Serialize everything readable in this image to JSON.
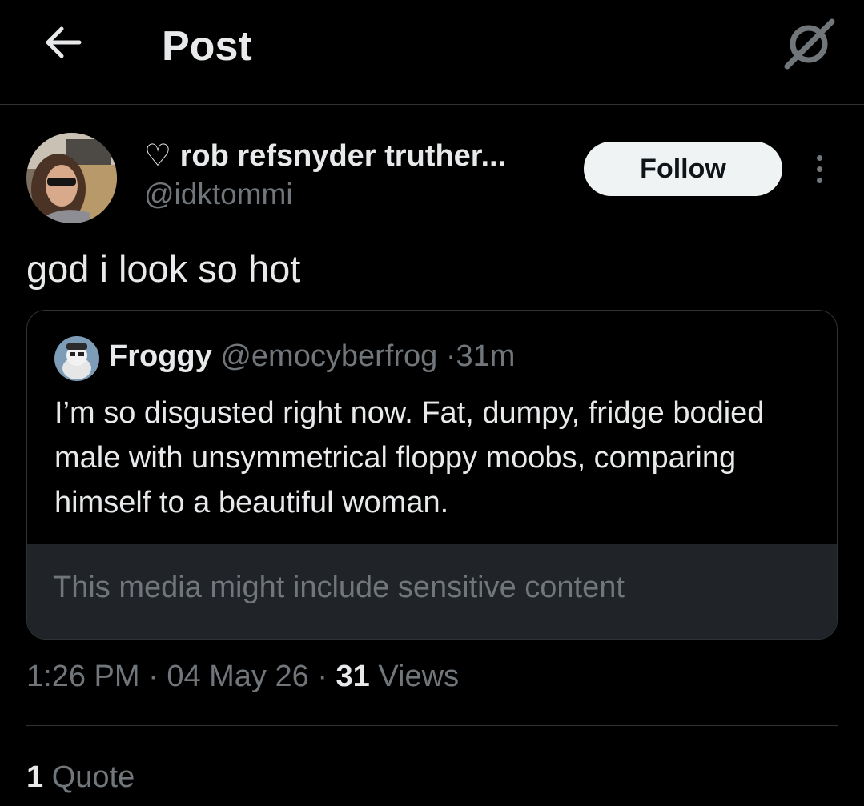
{
  "header": {
    "title": "Post",
    "back_icon": "arrow-left-icon",
    "grok_icon": "grok-icon"
  },
  "author": {
    "display_name": "♡ rob refsnyder truther...",
    "handle": "@idktommi",
    "follow_label": "Follow",
    "more_icon": "more-vertical-icon"
  },
  "post": {
    "text": "god i look so hot"
  },
  "quoted_post": {
    "name": "Froggy",
    "handle": "@emocyberfrog",
    "separator": "·",
    "time": "31m",
    "text": "I’m so disgusted right now. Fat, dumpy, fridge bodied male with unsymmetrical floppy moobs, comparing himself to a beautiful woman.",
    "sensitive_notice": "This media might include sensitive content"
  },
  "meta": {
    "time": "1:26 PM",
    "separator": "·",
    "date": "04 May 26",
    "views_count": "31",
    "views_label": "Views"
  },
  "stats": {
    "quote_count": "1",
    "quote_label": "Quote"
  },
  "colors": {
    "background": "#000000",
    "text_primary": "#e7e9ea",
    "text_secondary": "#71767b",
    "border": "#2f3336",
    "follow_bg": "#eff3f4",
    "sensitive_bg": "#202327"
  }
}
